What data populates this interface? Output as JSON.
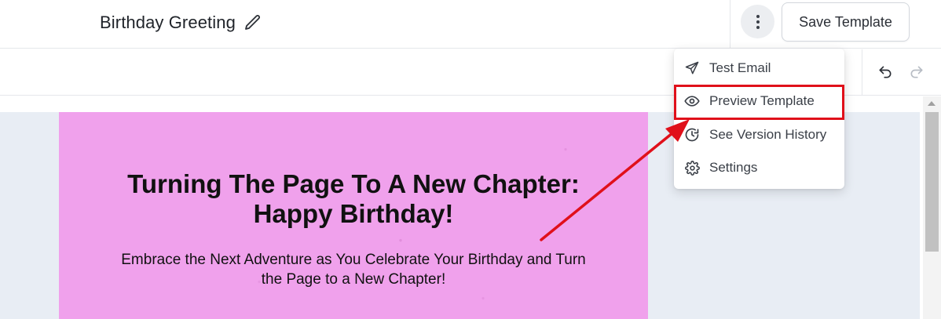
{
  "header": {
    "title": "Birthday Greeting",
    "save_label": "Save Template"
  },
  "menu": {
    "items": [
      {
        "label": "Test Email",
        "icon": "send-icon"
      },
      {
        "label": "Preview Template",
        "icon": "eye-icon"
      },
      {
        "label": "See Version History",
        "icon": "history-icon"
      },
      {
        "label": "Settings",
        "icon": "gear-icon"
      }
    ],
    "highlighted_item": "Preview Template"
  },
  "email": {
    "headline_line1": "Turning The Page To A New Chapter:",
    "headline_line2": "Happy Birthday!",
    "subtext_line1": "Embrace the Next Adventure as You Celebrate Your Birthday and Turn",
    "subtext_line2": "the Page to a New Chapter!"
  },
  "colors": {
    "card_background": "#f0a1ec",
    "canvas_background": "#e8edf4",
    "annotation": "#e0101a"
  }
}
